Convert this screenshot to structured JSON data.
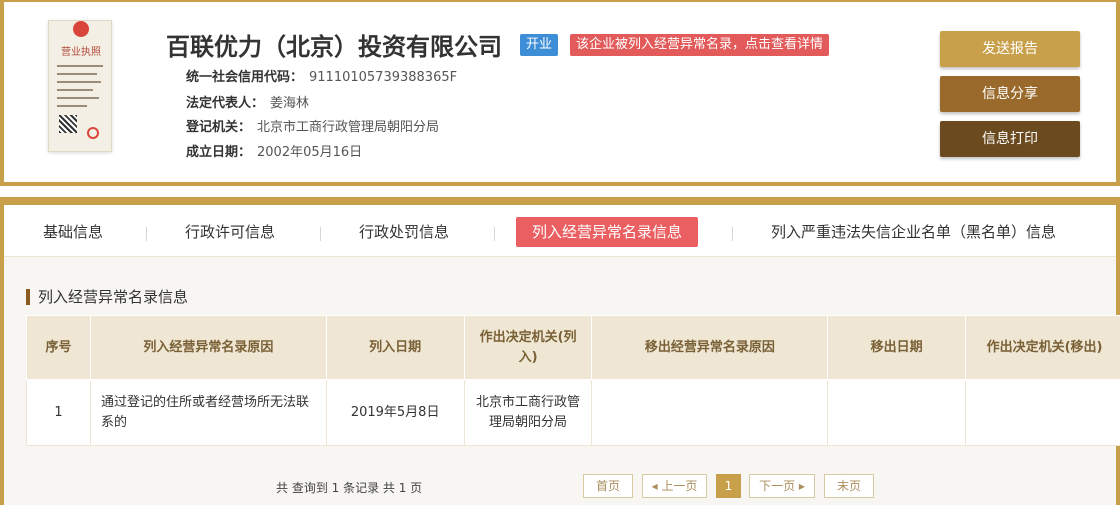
{
  "license": {
    "title": "营业执照"
  },
  "company": {
    "name": "百联优力（北京）投资有限公司",
    "status_tag": "开业",
    "warn_tag": "该企业被列入经营异常名录，点击查看详情"
  },
  "info": [
    {
      "label": "统一社会信用代码：",
      "value": "91110105739388365F"
    },
    {
      "label": "法定代表人：",
      "value": "姜海林"
    },
    {
      "label": "登记机关：",
      "value": "北京市工商行政管理局朝阳分局"
    },
    {
      "label": "成立日期：",
      "value": "2002年05月16日"
    }
  ],
  "actions": {
    "send": "发送报告",
    "share": "信息分享",
    "print": "信息打印"
  },
  "tabs": [
    {
      "label": "基础信息"
    },
    {
      "label": "行政许可信息"
    },
    {
      "label": "行政处罚信息"
    },
    {
      "label": "列入经营异常名录信息"
    },
    {
      "label": "列入严重违法失信企业名单（黑名单）信息"
    }
  ],
  "section_title": "列入经营异常名录信息",
  "table": {
    "headers": [
      "序号",
      "列入经营异常名录原因",
      "列入日期",
      "作出决定机关(列入)",
      "移出经营异常名录原因",
      "移出日期",
      "作出决定机关(移出)"
    ],
    "rows": [
      {
        "no": "1",
        "reason": "通过登记的住所或者经营场所无法联系的",
        "date": "2019年5月8日",
        "authority": "北京市工商行政管理局朝阳分局",
        "remove_reason": "",
        "remove_date": "",
        "remove_authority": ""
      }
    ]
  },
  "pager": {
    "info": "共 查询到 1 条记录 共 1 页",
    "first": "首页",
    "prev": "◂ 上一页",
    "current": "1",
    "next": "下一页 ▸",
    "last": "末页"
  }
}
